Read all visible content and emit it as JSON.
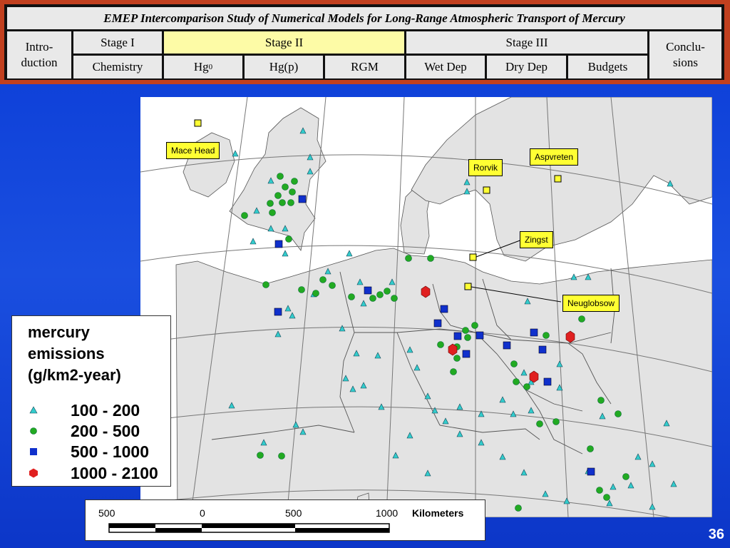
{
  "header": {
    "title": "EMEP Intercomparison Study of Numerical Models for Long-Range Atmospheric Transport of Mercury",
    "tabs": {
      "intro": "Intro-\nduction",
      "stage1": "Stage I",
      "stage2": "Stage II",
      "stage3": "Stage III",
      "conclusions": "Conclu-\nsions"
    },
    "subtabs": {
      "chemistry": "Chemistry",
      "hg0_base": "Hg",
      "hg0_sup": "0",
      "hgp": "Hg(p)",
      "rgm": "RGM",
      "wetdep": "Wet Dep",
      "drydep": "Dry Dep",
      "budgets": "Budgets"
    },
    "active_tab": "Stage II",
    "colors": {
      "frame": "#c1401f",
      "cell": "#e9e9e9",
      "active": "#fdfba6"
    }
  },
  "map": {
    "stations": [
      "Mace Head",
      "Rorvik",
      "Aspvreten",
      "Zingst",
      "Neuglobsow"
    ],
    "colors": {
      "land": "#e3e3e3",
      "sea": "#ffffff",
      "station": "#ffff33",
      "class1": "#33cccc",
      "class2": "#22aa22",
      "class3": "#1030cc",
      "class4": "#e02020"
    }
  },
  "legend": {
    "title_line1": "mercury",
    "title_line2": "emissions",
    "title_line3": "(g/km2-year)",
    "classes": [
      "100 - 200",
      "200 - 500",
      "500 - 1000",
      "1000 - 2100"
    ],
    "symbols": [
      "triangle",
      "circle",
      "square",
      "hexagon"
    ]
  },
  "scale_bar": {
    "ticks": [
      "500",
      "0",
      "500",
      "1000"
    ],
    "unit": "Kilometers"
  },
  "footer": {
    "page_number": "36"
  }
}
